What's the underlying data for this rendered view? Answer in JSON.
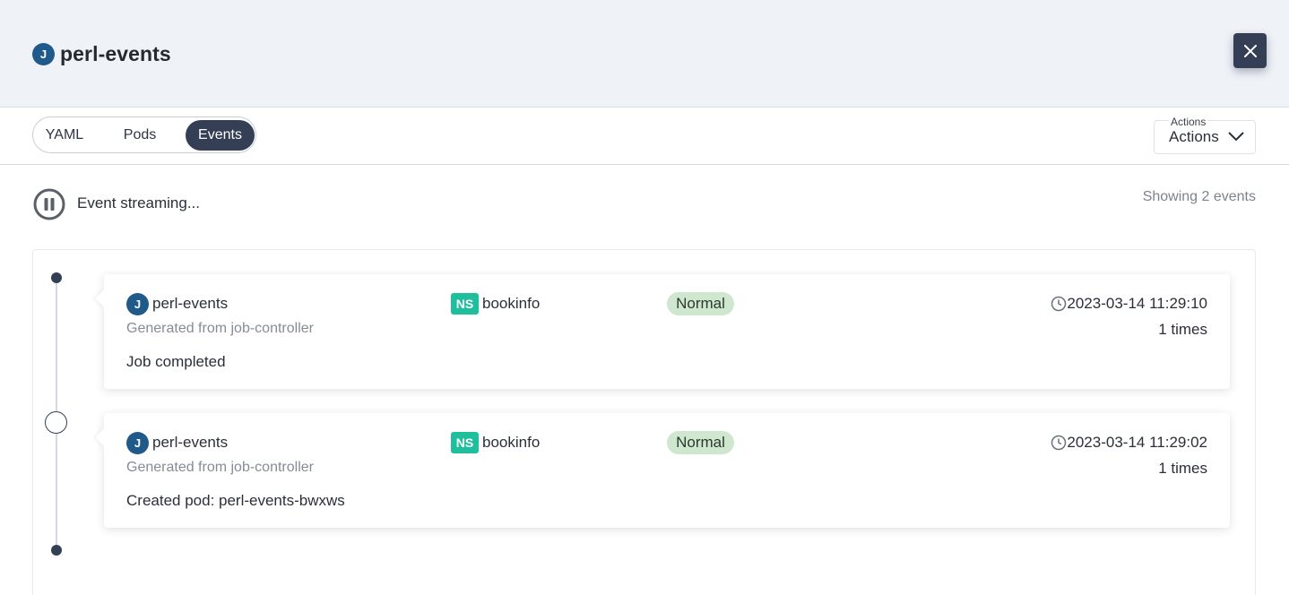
{
  "header": {
    "badge": "J",
    "title": "perl-events"
  },
  "tabs": [
    {
      "label": "YAML",
      "active": false
    },
    {
      "label": "Pods",
      "active": false
    },
    {
      "label": "Events",
      "active": true
    }
  ],
  "actions": {
    "floating_label": "Actions",
    "value": "Actions"
  },
  "stream": {
    "status": "Event streaming...",
    "count_text": "Showing 2 events"
  },
  "colors": {
    "accent": "#343f56",
    "badge": "#1f5a8a",
    "ns": "#1fbf9e",
    "normal_bg": "#cfe7cf"
  },
  "events": [
    {
      "badge": "J",
      "name": "perl-events",
      "source": "Generated from job-controller",
      "message": "Job completed",
      "ns_tag": "NS",
      "namespace": "bookinfo",
      "type": "Normal",
      "time": "2023-03-14 11:29:10",
      "count": "1 times"
    },
    {
      "badge": "J",
      "name": "perl-events",
      "source": "Generated from job-controller",
      "message": "Created pod: perl-events-bwxws",
      "ns_tag": "NS",
      "namespace": "bookinfo",
      "type": "Normal",
      "time": "2023-03-14 11:29:02",
      "count": "1 times"
    }
  ]
}
